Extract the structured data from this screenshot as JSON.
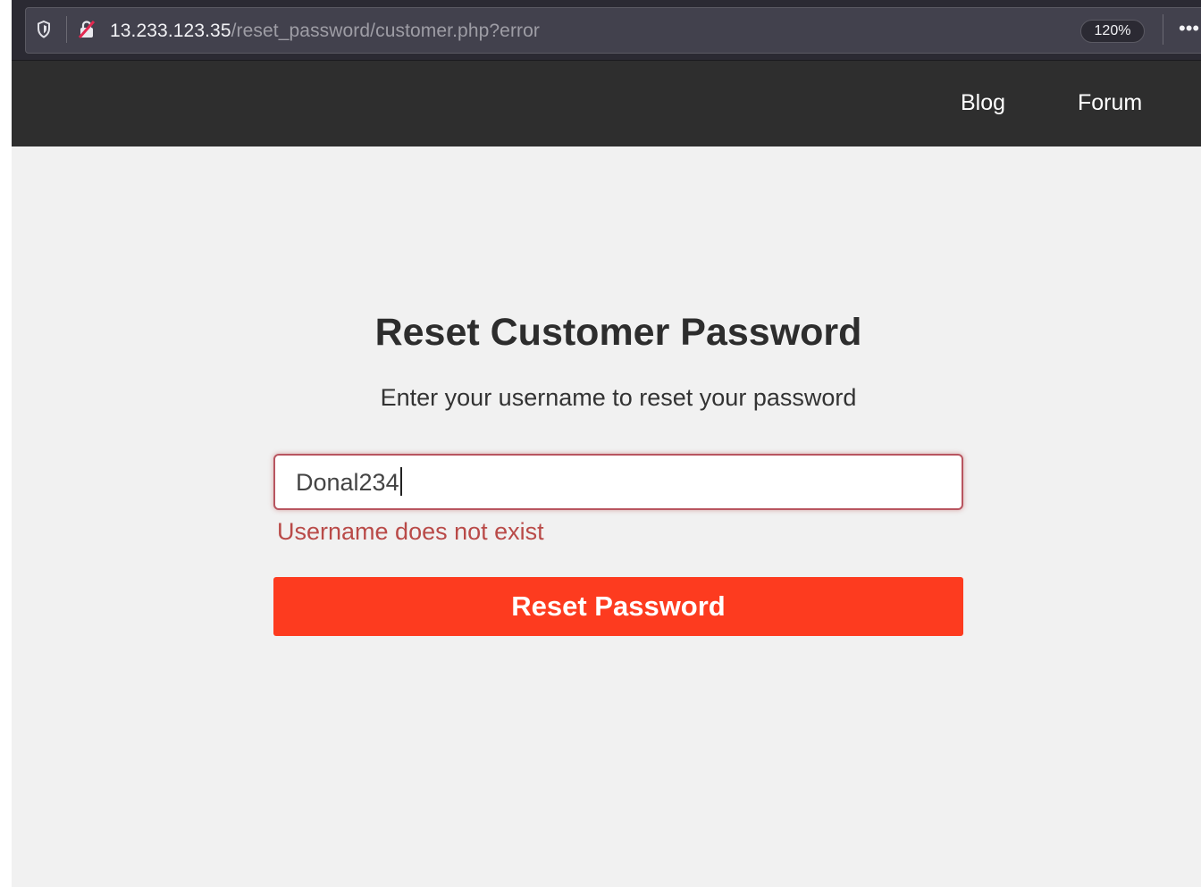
{
  "browser": {
    "url_host": "13.233.123.35",
    "url_path": "/reset_password/customer.php?error",
    "zoom": "120%",
    "shield_icon": "shield-icon",
    "lock_icon": "insecure-lock-icon",
    "menu_icon": "more-dots-icon",
    "menu_glyph": "•••"
  },
  "nav": {
    "links": [
      {
        "label": "Blog"
      },
      {
        "label": "Forum"
      }
    ]
  },
  "form": {
    "title": "Reset Customer Password",
    "subtitle": "Enter your username to reset your password",
    "username_value": "Donal234",
    "error": "Username does not exist",
    "submit_label": "Reset Password"
  },
  "colors": {
    "nav_bg": "#2e2e2e",
    "page_bg": "#f1f1f1",
    "error_text": "#b94a48",
    "button_bg": "#fd3b1f"
  }
}
